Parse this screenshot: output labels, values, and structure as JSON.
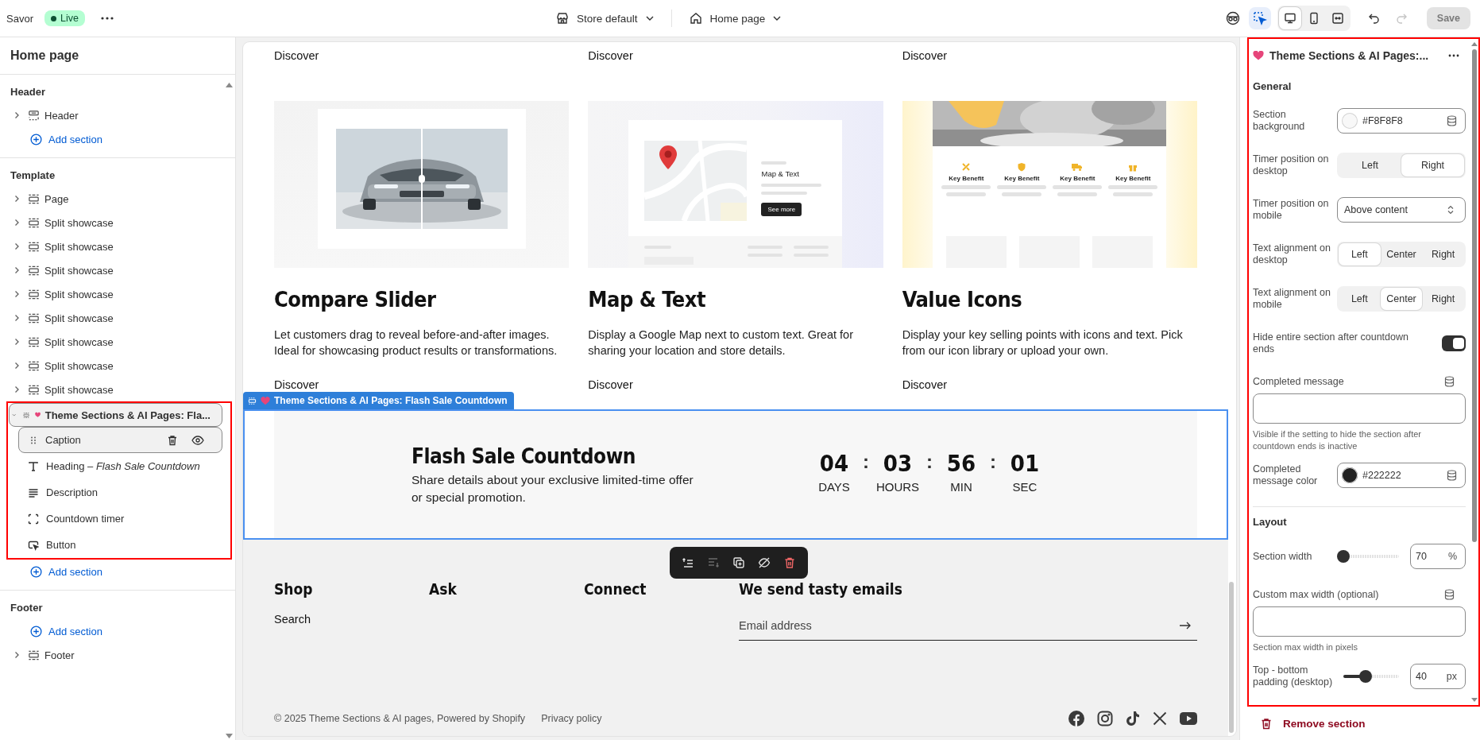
{
  "topbar": {
    "store": "Savor",
    "status": "Live",
    "theme_select": "Store default",
    "page_select": "Home page",
    "inspector_on": true,
    "view_modes": [
      {
        "kind": "desktop",
        "selected": true
      },
      {
        "kind": "mobile",
        "selected": false
      },
      {
        "kind": "fullwidth",
        "selected": false
      }
    ],
    "history": [
      {
        "kind": "undo",
        "disabled": false
      },
      {
        "kind": "redo",
        "disabled": true
      }
    ],
    "save": {
      "label": "Save",
      "disabled": true
    }
  },
  "sidebar": {
    "title": "Home page",
    "groups": [
      {
        "title": "Header",
        "entries": [
          {
            "kind": "header-section",
            "label": "Header",
            "selected": false,
            "expanded": false
          },
          {
            "kind": "add",
            "label": "Add section"
          }
        ]
      },
      {
        "title": "Template",
        "entries": [
          {
            "kind": "section",
            "label": "Page",
            "selected": false,
            "expanded": false
          },
          {
            "kind": "section",
            "label": "Split showcase",
            "selected": false,
            "expanded": false
          },
          {
            "kind": "section",
            "label": "Split showcase",
            "selected": false,
            "expanded": false
          },
          {
            "kind": "section",
            "label": "Split showcase",
            "selected": false,
            "expanded": false
          },
          {
            "kind": "section",
            "label": "Split showcase",
            "selected": false,
            "expanded": false
          },
          {
            "kind": "section",
            "label": "Split showcase",
            "selected": false,
            "expanded": false
          },
          {
            "kind": "section",
            "label": "Split showcase",
            "selected": false,
            "expanded": false
          },
          {
            "kind": "section",
            "label": "Split showcase",
            "selected": false,
            "expanded": false
          },
          {
            "kind": "section",
            "label": "Split showcase",
            "selected": false,
            "expanded": false
          },
          {
            "kind": "app-section",
            "label": "Theme Sections & AI Pages: Fla...",
            "selected": true,
            "expanded": true,
            "highlighted": true,
            "children": [
              {
                "kind": "caption",
                "label": "Caption",
                "selected": true
              },
              {
                "kind": "heading",
                "label": "Heading – *Flash Sale Countdown*",
                "selected": false
              },
              {
                "kind": "description",
                "label": "Description",
                "selected": false
              },
              {
                "kind": "timer",
                "label": "Countdown timer",
                "selected": false
              },
              {
                "kind": "button",
                "label": "Button",
                "selected": false
              }
            ]
          },
          {
            "kind": "add",
            "label": "Add section"
          }
        ]
      },
      {
        "title": "Footer",
        "entries": [
          {
            "kind": "add",
            "label": "Add section"
          },
          {
            "kind": "section",
            "label": "Footer",
            "selected": false,
            "expanded": false
          }
        ]
      }
    ]
  },
  "preview": {
    "top_links": [
      "Discover",
      "Discover",
      "Discover"
    ],
    "cards": [
      {
        "kind": "compare",
        "title": "Compare Slider",
        "text": "Let customers drag to reveal before-and-after images. Ideal for showcasing product results or transformations.",
        "link": "Discover"
      },
      {
        "kind": "map",
        "mock_title": "Map & Text",
        "mock_button": "See more",
        "title": "Map & Text",
        "text": "Display a Google Map next to custom text. Great for sharing your location and store details.",
        "link": "Discover"
      },
      {
        "kind": "benefits",
        "benefits": [
          {
            "kind": "tools",
            "label": "Key Benefit"
          },
          {
            "kind": "shield",
            "label": "Key Benefit"
          },
          {
            "kind": "truck",
            "label": "Key Benefit"
          },
          {
            "kind": "gift",
            "label": "Key Benefit"
          }
        ],
        "title": "Value Icons",
        "text": "Display your key selling points with icons and text. Pick from our icon library or upload your own.",
        "link": "Discover"
      }
    ],
    "section_tag": "Theme Sections & AI Pages: Flash Sale Countdown",
    "countdown": {
      "heading": "Flash Sale Countdown",
      "text": "Share details about your exclusive limited-time offer or special promotion.",
      "separator": ":",
      "units": [
        {
          "value": "04",
          "label": "DAYS"
        },
        {
          "value": "03",
          "label": "HOURS"
        },
        {
          "value": "56",
          "label": "MIN"
        },
        {
          "value": "01",
          "label": "SEC"
        }
      ]
    },
    "toolbar": [
      {
        "kind": "move-up",
        "disabled": false
      },
      {
        "kind": "move-down",
        "disabled": true
      },
      {
        "kind": "duplicate",
        "disabled": false
      },
      {
        "kind": "hide",
        "disabled": false
      },
      {
        "kind": "delete",
        "disabled": false
      }
    ],
    "footer": {
      "columns": [
        {
          "title": "Shop",
          "links": [
            "Search"
          ]
        },
        {
          "title": "Ask"
        },
        {
          "title": "Connect"
        }
      ],
      "newsletter": {
        "title": "We send tasty emails",
        "placeholder": "Email address"
      },
      "copyright": "© 2025 Theme Sections & AI pages, Powered by Shopify",
      "policy": "Privacy policy",
      "socials": [
        {
          "kind": "facebook"
        },
        {
          "kind": "instagram"
        },
        {
          "kind": "tiktok"
        },
        {
          "kind": "x"
        },
        {
          "kind": "youtube"
        }
      ]
    }
  },
  "settings": {
    "title": "Theme Sections & AI Pages:...",
    "highlighted": true,
    "groups": [
      {
        "title": "General",
        "fields": [
          {
            "kind": "color",
            "label": "Section background",
            "value": "#F8F8F8",
            "color": "#f8f8f8"
          },
          {
            "kind": "segmented",
            "label": "Timer position on desktop",
            "options": [
              {
                "label": "Left",
                "selected": false
              },
              {
                "label": "Right",
                "selected": true
              }
            ]
          },
          {
            "kind": "select",
            "label": "Timer position on mobile",
            "value": "Above content"
          },
          {
            "kind": "segmented",
            "label": "Text alignment on desktop",
            "options": [
              {
                "label": "Left",
                "selected": true
              },
              {
                "label": "Center",
                "selected": false
              },
              {
                "label": "Right",
                "selected": false
              }
            ]
          },
          {
            "kind": "segmented",
            "label": "Text alignment on mobile",
            "options": [
              {
                "label": "Left",
                "selected": false
              },
              {
                "label": "Center",
                "selected": true
              },
              {
                "label": "Right",
                "selected": false
              }
            ]
          },
          {
            "kind": "toggle",
            "label": "Hide entire section after countdown ends",
            "on": true
          },
          {
            "kind": "textarea",
            "label": "Completed message",
            "help": "Visible if the setting to hide the section after countdown ends is inactive"
          },
          {
            "kind": "color",
            "label": "Completed message color",
            "value": "#222222",
            "color": "#222222"
          }
        ]
      },
      {
        "title": "Layout",
        "fields": [
          {
            "kind": "range",
            "label": "Section width",
            "level": 0,
            "value": "70",
            "unit": "%"
          },
          {
            "kind": "textarea",
            "label": "Custom max width (optional)",
            "help": "Section max width in pixels"
          },
          {
            "kind": "range",
            "label": "Top - bottom padding (desktop)",
            "level": 0.4,
            "value": "40",
            "unit": "px"
          }
        ]
      }
    ],
    "remove": "Remove section"
  }
}
